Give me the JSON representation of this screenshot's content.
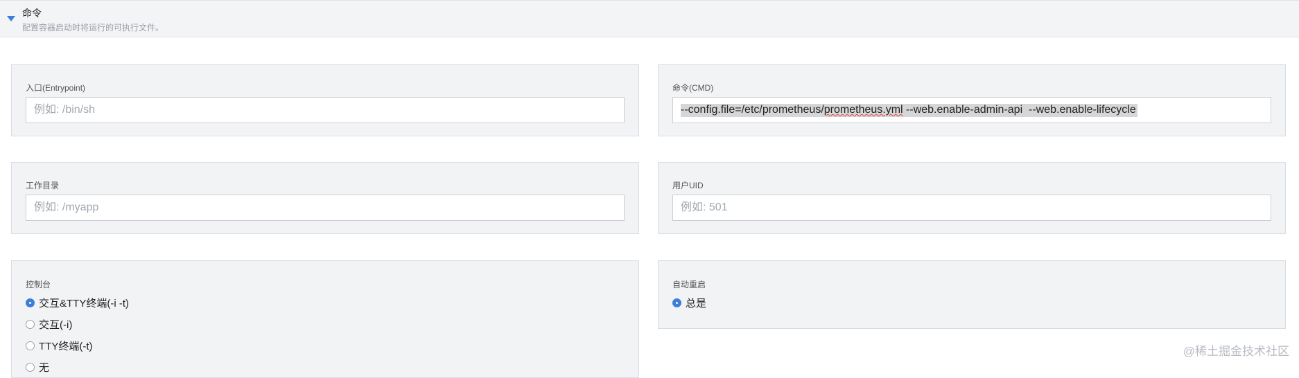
{
  "section": {
    "title": "命令",
    "description": "配置容器启动时将运行的可执行文件。"
  },
  "entrypoint": {
    "label": "入口(Entrypoint)",
    "placeholder": "例如: /bin/sh",
    "value": ""
  },
  "cmd": {
    "label": "命令(CMD)",
    "value_part1": "--config.file=/etc/prometheus/",
    "value_misspelled": "prometheus.yml",
    "value_part2": " --web.enable-admin-api  --web.enable-lifecycle"
  },
  "workdir": {
    "label": "工作目录",
    "placeholder": "例如: /myapp",
    "value": ""
  },
  "uid": {
    "label": "用户UID",
    "placeholder": "例如: 501",
    "value": ""
  },
  "console": {
    "label": "控制台",
    "options": [
      {
        "label": "交互&TTY终端(-i -t)",
        "checked": true
      },
      {
        "label": "交互(-i)",
        "checked": false
      },
      {
        "label": "TTY终端(-t)",
        "checked": false
      },
      {
        "label": "无",
        "checked": false
      }
    ]
  },
  "restart": {
    "label": "自动重启",
    "options": [
      {
        "label": "总是",
        "checked": true
      }
    ]
  },
  "watermark": "@稀土掘金技术社区",
  "colors": {
    "accent": "#3d7fd8",
    "panel": "#f2f3f5",
    "border": "#d9dde2"
  }
}
